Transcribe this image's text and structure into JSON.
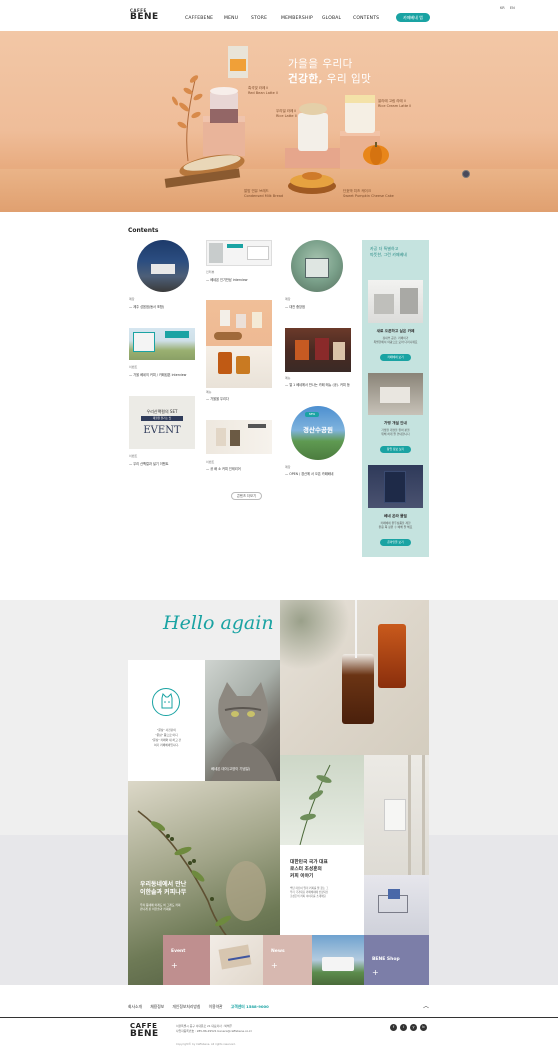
{
  "header": {
    "logo_top": "CAFFE",
    "logo_bottom": "BENE",
    "nav": [
      "CAFFEBENE",
      "MENU",
      "STORE",
      "MEMBERSHIP",
      "GLOBAL",
      "CONTENTS"
    ],
    "top_links": [
      "KR",
      "EN"
    ],
    "join_label": "카페베네 앱"
  },
  "hero": {
    "title_line1": "가을을 우리다",
    "title_line2_bold": "건강한,",
    "title_line2_rest": " 우리 입맛",
    "products": [
      {
        "ko": "흑석빛 라떼 ll",
        "en": "Red Bean Latte ll"
      },
      {
        "ko": "우리밀 라떼 ll",
        "en": "Rice Latte ll"
      },
      {
        "ko": "쌀라떼 고림 라떼 ll",
        "en": "Rice Cream Latte ll"
      },
      {
        "ko": "알밤 연유 브레드",
        "en": "Condensed Milk Bread"
      },
      {
        "ko": "단호박 치즈 케이크",
        "en": "Sweet Pumpkin Cheese Cake"
      }
    ]
  },
  "contents": {
    "section_title": "Contents",
    "cards": [
      {
        "category": "매장",
        "title": "— 제주 성읍점(동서 포함)"
      },
      {
        "category": "인터뷰",
        "title": "— 베네몬 인기만남 interview"
      },
      {
        "category": "매장",
        "title": "— 대전 중앙점"
      },
      {
        "category": "이벤트",
        "title": "— 가을 베네의 커피 / 카페컵폰 interview"
      },
      {
        "category": "메뉴",
        "title": "— 가을을 우리다"
      },
      {
        "category": "메뉴",
        "title": "— 열 1 베네에서 만나는 카페 메뉴 (공). 커피 등"
      },
      {
        "category": "이벤트",
        "title": "— 우리 산팩컬과 설기 이벤트"
      },
      {
        "category": "이벤트",
        "title": "— 공 배 소 커피 인테리어"
      },
      {
        "category": "매장",
        "title": "— OPEN / 경산에 서 오픈 카페베네"
      }
    ],
    "event_card": {
      "top": "우리산팩컬의 SET",
      "middle": "제철을 즐기는 맛",
      "big": "EVENT"
    },
    "tag_new": "NEW",
    "green_circle_text": "경산수공원",
    "more_label": "콘텐츠 더보기"
  },
  "side": {
    "head_line1": "카공 더 특별하고",
    "head_line2": "따뜻한, 그런 카페베네",
    "items": [
      {
        "title": "새로 오픈하고 싶은 카페",
        "desc1": "점내부 공간, 카페이가",
        "desc2": "특별한에서 야광으로 모아 다리니께요",
        "btn": "카페베네 보기"
      },
      {
        "title": "가맹 개설 안내",
        "desc1": "가맹을 개설을 원하 분을",
        "desc2": "위해 하게 잘 안내합니다",
        "btn": "창업 정보 보기"
      },
      {
        "title": "베네 온라 몰밀",
        "desc1": "카페베네 원두상품을 제한",
        "desc2": "원용 쭉 정원 수 배해 잘 해요",
        "btn": "온라인몰 보기"
      }
    ]
  },
  "hello": {
    "title": "Hello again",
    "cat_text1": "\"문삼\" 사진같이",
    "cat_text2": "\"문삼\" 쯤으로 어디",
    "cat_text3": "\"문삼\" 카페와 새 하고 간",
    "cat_text4": "여기 카페베네입니다.",
    "cat_photo_label": "베네몬 데이(고양이 기념일)",
    "coffee_story_title1": "우리동네에서 만난",
    "coffee_story_title2": "이한솔과 커피나무",
    "coffee_story_desc1": "우리 동네에 이래도 비 그래도 커피",
    "coffee_story_desc2": "만나게 된 이한솔과 커피를",
    "roaster_title1": "대한민국 국가 대표",
    "roaster_title2": "로스터 조성훈의",
    "roaster_title3": "커피 이야기",
    "roaster_desc1": "백년 라틴이 멀리 커피를 잘 찾는 그",
    "roaster_desc2": "우리 국가대표 카페베네에 인정되신",
    "roaster_desc3": "조성훈의 커피 이야기를 소개해요",
    "tile_event": "Event",
    "tile_news": "News",
    "tile_shop": "BENE Shop"
  },
  "footer": {
    "links": [
      "회사소개",
      "채용정보",
      "개인정보처리방침",
      "이용약관",
      "고객센터 1588-9000"
    ],
    "logo_top": "CAFFE",
    "logo_bottom": "BENE",
    "info1": "서울특별시 중구 서대문로 21   대표이사 : 박해주",
    "info2": "사업자등록번호 : 285-86-29521   benecs@caffebene.co.kr",
    "copyright": "Copyright© by Caffebene. All rights reserved.",
    "social": [
      "f",
      "i",
      "y",
      "b"
    ],
    "top_arrow": "︿"
  },
  "colors": {
    "accent": "#1aa3a3",
    "hero": "#efbd99",
    "side": "#c5e3df"
  }
}
